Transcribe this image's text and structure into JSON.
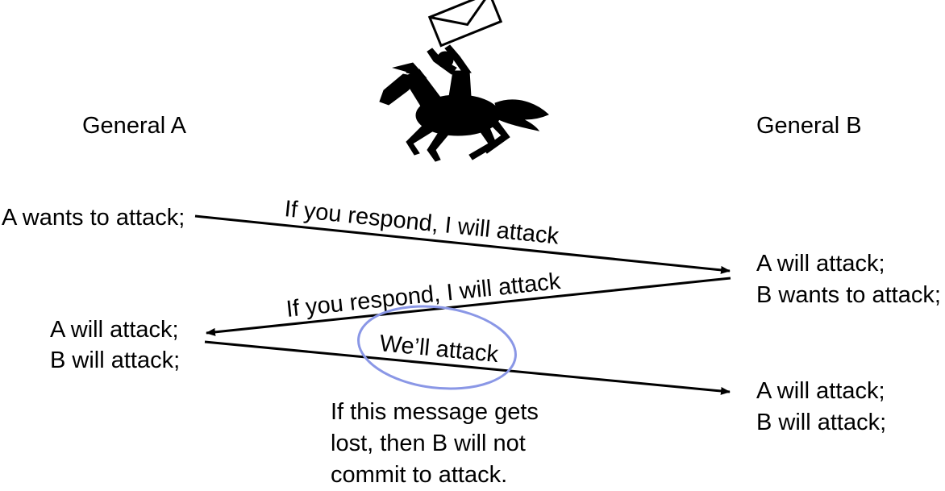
{
  "generals": {
    "a": {
      "title": "General A"
    },
    "b": {
      "title": "General B"
    }
  },
  "states": {
    "a_initial": "A wants to attack;",
    "b_after_first": [
      "A will attack;",
      "B wants to attack;"
    ],
    "a_after_second": [
      "A will attack;",
      "B will attack;"
    ],
    "b_after_third": [
      "A will attack;",
      "B will attack;"
    ]
  },
  "messages": {
    "first": "If you respond, I will attack",
    "second": "If you respond, I will attack",
    "third": "We’ll attack"
  },
  "note": {
    "lines": [
      "If this message gets",
      "lost, then B will not",
      "commit to attack."
    ]
  },
  "icons": {
    "envelope": "envelope-icon",
    "messenger": "horse-rider-icon"
  },
  "colors": {
    "ink": "#000000",
    "highlight": "#8a97e6"
  }
}
